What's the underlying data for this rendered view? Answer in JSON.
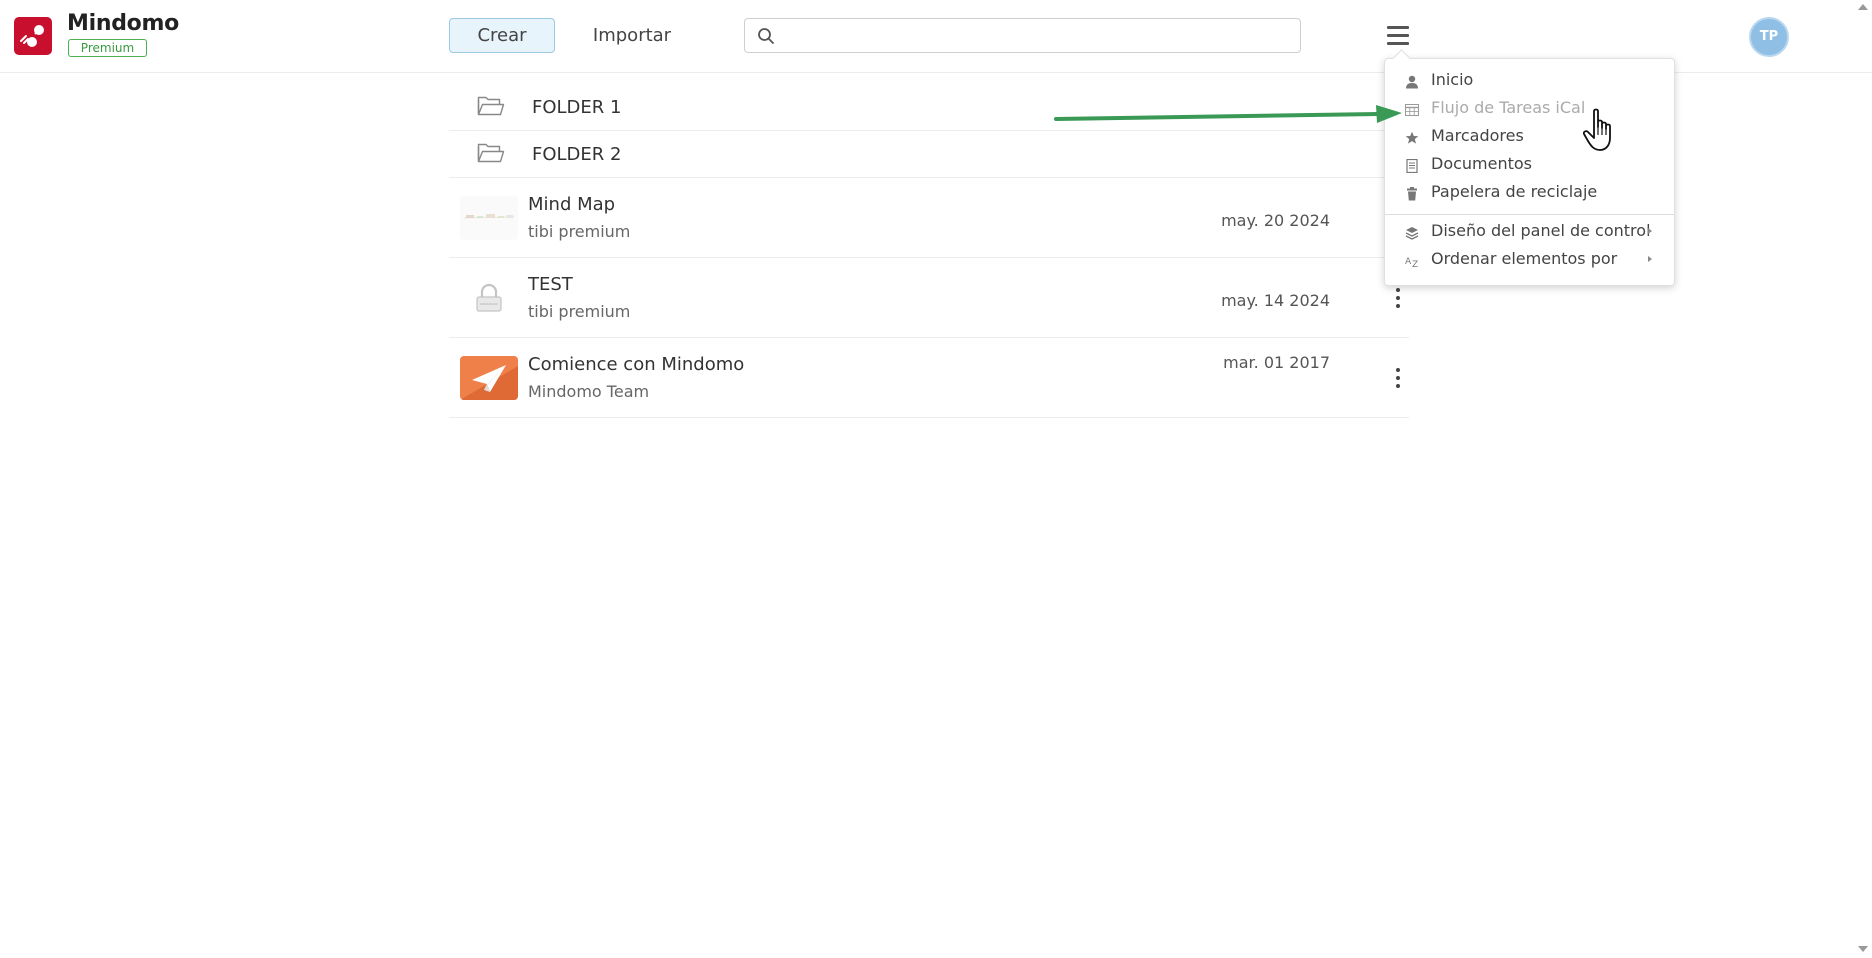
{
  "header": {
    "app_name": "Mindomo",
    "badge": "Premium",
    "create_label": "Crear",
    "import_label": "Importar",
    "search": {
      "value": "",
      "placeholder": ""
    },
    "avatar_initials": "TP"
  },
  "folders": [
    {
      "name": "FOLDER 1",
      "icon": "folder-open-icon"
    },
    {
      "name": "FOLDER 2",
      "icon": "folder-open-icon"
    }
  ],
  "maps": [
    {
      "title": "Mind Map",
      "owner": "tibi premium",
      "date": "may. 20 2024",
      "thumb": "mind-map-thumbnail"
    },
    {
      "title": "TEST",
      "owner": "tibi premium",
      "date": "may. 14 2024",
      "thumb": "lock-icon"
    },
    {
      "title": "Comience con Mindomo",
      "owner": "Mindomo Team",
      "date": "mar. 01 2017",
      "thumb": "paper-plane-icon"
    }
  ],
  "menu": {
    "items": [
      {
        "label": "Inicio",
        "icon": "user-icon",
        "disabled": false
      },
      {
        "label": "Flujo de Tareas iCal",
        "icon": "calendar-grid-icon",
        "disabled": true
      },
      {
        "label": "Marcadores",
        "icon": "star-icon",
        "disabled": false
      },
      {
        "label": "Documentos",
        "icon": "document-icon",
        "disabled": false
      },
      {
        "label": "Papelera de reciclaje",
        "icon": "trash-icon",
        "disabled": false
      }
    ],
    "submenus": [
      {
        "label": "Diseño del panel de control",
        "icon": "layers-icon"
      },
      {
        "label": "Ordenar elementos por",
        "icon": "sort-az-icon"
      }
    ]
  },
  "colors": {
    "brand": "#c8102e",
    "premium": "#4caf50",
    "create_bg": "#e8f4fb",
    "avatar": "#8fbfe5",
    "annotation_arrow": "#3a9a55"
  }
}
